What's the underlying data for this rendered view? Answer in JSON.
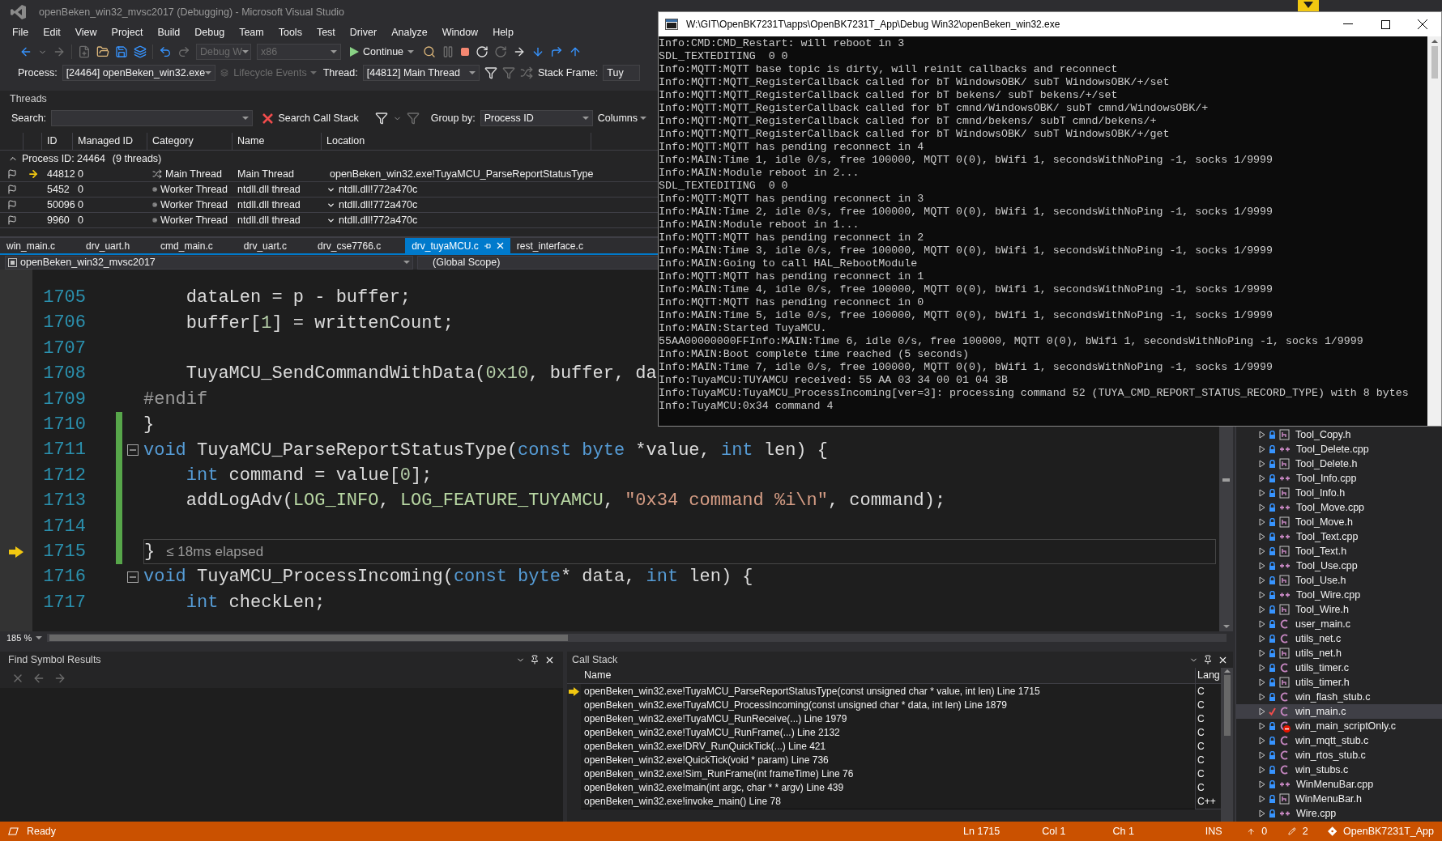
{
  "title": "openBeken_win32_mvsc2017 (Debugging) - Microsoft Visual Studio",
  "menu": [
    "File",
    "Edit",
    "View",
    "Project",
    "Build",
    "Debug",
    "Team",
    "Tools",
    "Test",
    "Driver",
    "Analyze",
    "Window",
    "Help"
  ],
  "toolbar": {
    "configuration": "Debug W",
    "platform": "x86",
    "continue": "Continue"
  },
  "debug_location": {
    "process_label": "Process:",
    "process": "[24464] openBeken_win32.exe",
    "lifecycle": "Lifecycle Events",
    "thread_label": "Thread:",
    "thread": "[44812] Main Thread",
    "stack_frame_label": "Stack Frame:",
    "stack_frame": "Tuy"
  },
  "threads": {
    "title": "Threads",
    "search_label": "Search:",
    "search_call_stack": "Search Call Stack",
    "group_by_label": "Group by:",
    "group_by": "Process ID",
    "columns_button": "Columns",
    "columns": [
      "ID",
      "Managed ID",
      "Category",
      "Name",
      "Location"
    ],
    "group": {
      "label": "Process ID: 24464",
      "count": "(9 threads)",
      "expanded": true
    },
    "rows": [
      {
        "id": "44812",
        "managed_id": "0",
        "kind": "main",
        "category": "Main Thread",
        "name": "Main Thread",
        "location": "openBeken_win32.exe!TuyaMCU_ParseReportStatusType",
        "current": true
      },
      {
        "id": "5452",
        "managed_id": "0",
        "kind": "worker",
        "category": "Worker Thread",
        "name": "ntdll.dll thread",
        "location": "ntdll.dll!772a470c",
        "current": false
      },
      {
        "id": "50096",
        "managed_id": "0",
        "kind": "worker",
        "category": "Worker Thread",
        "name": "ntdll.dll thread",
        "location": "ntdll.dll!772a470c",
        "current": false
      },
      {
        "id": "9960",
        "managed_id": "0",
        "kind": "worker",
        "category": "Worker Thread",
        "name": "ntdll.dll thread",
        "location": "ntdll.dll!772a470c",
        "current": false
      }
    ]
  },
  "editor_tabs": [
    {
      "label": "win_main.c",
      "selected": false
    },
    {
      "label": "drv_uart.h",
      "selected": false
    },
    {
      "label": "cmd_main.c",
      "selected": false
    },
    {
      "label": "drv_uart.c",
      "selected": false
    },
    {
      "label": "drv_cse7766.c",
      "selected": false
    },
    {
      "label": "drv_tuyaMCU.c",
      "selected": true
    },
    {
      "label": "rest_interface.c",
      "selected": false
    }
  ],
  "nav": {
    "project": "openBeken_win32_mvsc2017",
    "scope": "(Global Scope)"
  },
  "code": {
    "elapsed_hint": "≤ 18ms elapsed",
    "lines": [
      {
        "number": "1705",
        "changed": false,
        "fold": false,
        "current": false,
        "tokens": [
          {
            "kind": "plain",
            "text": "    dataLen = p - buffer;"
          }
        ]
      },
      {
        "number": "1706",
        "changed": false,
        "fold": false,
        "current": false,
        "tokens": [
          {
            "kind": "plain",
            "text": "    buffer["
          },
          {
            "kind": "num",
            "text": "1"
          },
          {
            "kind": "plain",
            "text": "] = writtenCount;"
          }
        ]
      },
      {
        "number": "1707",
        "changed": false,
        "fold": false,
        "current": false
      },
      {
        "number": "1708",
        "changed": false,
        "fold": false,
        "current": false,
        "tokens": [
          {
            "kind": "plain",
            "text": "    TuyaMCU_SendCommandWithData("
          },
          {
            "kind": "num",
            "text": "0x10"
          },
          {
            "kind": "plain",
            "text": ", buffer, da"
          }
        ]
      },
      {
        "number": "1709",
        "changed": false,
        "fold": false,
        "current": false,
        "tokens": [
          {
            "kind": "pre",
            "text": "#endif"
          }
        ]
      },
      {
        "number": "1710",
        "changed": true,
        "fold": false,
        "current": false,
        "tokens": [
          {
            "kind": "plain",
            "text": "}"
          }
        ]
      },
      {
        "number": "1711",
        "changed": true,
        "fold": true,
        "current": false,
        "tokens": [
          {
            "kind": "kw",
            "text": "void"
          },
          {
            "kind": "plain",
            "text": " TuyaMCU_ParseReportStatusType("
          },
          {
            "kind": "kw",
            "text": "const byte"
          },
          {
            "kind": "plain",
            "text": " *value, "
          },
          {
            "kind": "kw",
            "text": "int"
          },
          {
            "kind": "plain",
            "text": " len) {"
          }
        ]
      },
      {
        "number": "1712",
        "changed": true,
        "fold": false,
        "current": false,
        "tokens": [
          {
            "kind": "kw",
            "text": "    int"
          },
          {
            "kind": "plain",
            "text": " command = value["
          },
          {
            "kind": "num",
            "text": "0"
          },
          {
            "kind": "plain",
            "text": "];"
          }
        ]
      },
      {
        "number": "1713",
        "changed": true,
        "fold": false,
        "current": false,
        "tokens": [
          {
            "kind": "plain",
            "text": "    addLogAdv("
          },
          {
            "kind": "enum",
            "text": "LOG_INFO"
          },
          {
            "kind": "plain",
            "text": ", "
          },
          {
            "kind": "enum",
            "text": "LOG_FEATURE_TUYAMCU"
          },
          {
            "kind": "plain",
            "text": ", "
          },
          {
            "kind": "str",
            "text": "\"0x34 command %i\\n\""
          },
          {
            "kind": "plain",
            "text": ", command);"
          }
        ]
      },
      {
        "number": "1714",
        "changed": true,
        "fold": false,
        "current": false
      },
      {
        "number": "1715",
        "changed": true,
        "fold": false,
        "current": true,
        "tokens": [
          {
            "kind": "plain",
            "text": "}"
          }
        ]
      },
      {
        "number": "1716",
        "changed": false,
        "fold": true,
        "current": false,
        "tokens": [
          {
            "kind": "kw",
            "text": "void"
          },
          {
            "kind": "plain",
            "text": " TuyaMCU_ProcessIncoming("
          },
          {
            "kind": "kw",
            "text": "const byte"
          },
          {
            "kind": "plain",
            "text": "* data, "
          },
          {
            "kind": "kw",
            "text": "int"
          },
          {
            "kind": "plain",
            "text": " len) {"
          }
        ]
      },
      {
        "number": "1717",
        "changed": false,
        "fold": false,
        "current": false,
        "tokens": [
          {
            "kind": "kw",
            "text": "    int"
          },
          {
            "kind": "plain",
            "text": " checkLen;"
          }
        ]
      }
    ]
  },
  "zoom": "185 %",
  "find_symbol": {
    "title": "Find Symbol Results"
  },
  "call_stack": {
    "title": "Call Stack",
    "columns": [
      "Name",
      "Lang"
    ],
    "rows": [
      {
        "name": "openBeken_win32.exe!TuyaMCU_ParseReportStatusType(const unsigned char * value, int len) Line 1715",
        "lang": "C",
        "current": true
      },
      {
        "name": "openBeken_win32.exe!TuyaMCU_ProcessIncoming(const unsigned char * data, int len) Line 1879",
        "lang": "C",
        "current": false
      },
      {
        "name": "openBeken_win32.exe!TuyaMCU_RunReceive(...) Line 1979",
        "lang": "C",
        "current": false
      },
      {
        "name": "openBeken_win32.exe!TuyaMCU_RunFrame(...) Line 2132",
        "lang": "C",
        "current": false
      },
      {
        "name": "openBeken_win32.exe!DRV_RunQuickTick(...) Line 421",
        "lang": "C",
        "current": false
      },
      {
        "name": "openBeken_win32.exe!QuickTick(void * param) Line 736",
        "lang": "C",
        "current": false
      },
      {
        "name": "openBeken_win32.exe!Sim_RunFrame(int frameTime) Line 76",
        "lang": "C",
        "current": false
      },
      {
        "name": "openBeken_win32.exe!main(int argc, char * * argv) Line 439",
        "lang": "C",
        "current": false
      },
      {
        "name": "openBeken_win32.exe!invoke_main() Line 78",
        "lang": "C++",
        "current": false
      }
    ]
  },
  "console": {
    "title": "W:\\GIT\\OpenBK7231T\\apps\\OpenBK7231T_App\\Debug Win32\\openBeken_win32.exe",
    "lines": [
      "Info:CMD:CMD_Restart: will reboot in 3",
      "SDL_TEXTEDITING  0 0",
      "Info:MQTT:MQTT base topic is dirty, will reinit callbacks and reconnect",
      "Info:MQTT:MQTT_RegisterCallback called for bT WindowsOBK/ subT WindowsOBK/+/set",
      "Info:MQTT:MQTT_RegisterCallback called for bT bekens/ subT bekens/+/set",
      "Info:MQTT:MQTT_RegisterCallback called for bT cmnd/WindowsOBK/ subT cmnd/WindowsOBK/+",
      "Info:MQTT:MQTT_RegisterCallback called for bT cmnd/bekens/ subT cmnd/bekens/+",
      "Info:MQTT:MQTT_RegisterCallback called for bT WindowsOBK/ subT WindowsOBK/+/get",
      "Info:MQTT:MQTT has pending reconnect in 4",
      "Info:MAIN:Time 1, idle 0/s, free 100000, MQTT 0(0), bWifi 1, secondsWithNoPing -1, socks 1/9999",
      "Info:MAIN:Module reboot in 2...",
      "SDL_TEXTEDITING  0 0",
      "Info:MQTT:MQTT has pending reconnect in 3",
      "Info:MAIN:Time 2, idle 0/s, free 100000, MQTT 0(0), bWifi 1, secondsWithNoPing -1, socks 1/9999",
      "Info:MAIN:Module reboot in 1...",
      "Info:MQTT:MQTT has pending reconnect in 2",
      "Info:MAIN:Time 3, idle 0/s, free 100000, MQTT 0(0), bWifi 1, secondsWithNoPing -1, socks 1/9999",
      "Info:MAIN:Going to call HAL_RebootModule",
      "Info:MQTT:MQTT has pending reconnect in 1",
      "Info:MAIN:Time 4, idle 0/s, free 100000, MQTT 0(0), bWifi 1, secondsWithNoPing -1, socks 1/9999",
      "Info:MQTT:MQTT has pending reconnect in 0",
      "Info:MAIN:Time 5, idle 0/s, free 100000, MQTT 0(0), bWifi 1, secondsWithNoPing -1, socks 1/9999",
      "Info:MAIN:Started TuyaMCU.",
      "55AA00000000FFInfo:MAIN:Time 6, idle 0/s, free 100000, MQTT 0(0), bWifi 1, secondsWithNoPing -1, socks 1/9999",
      "Info:MAIN:Boot complete time reached (5 seconds)",
      "Info:MAIN:Time 7, idle 0/s, free 100000, MQTT 0(0), bWifi 1, secondsWithNoPing -1, socks 1/9999",
      "Info:TuyaMCU:TUYAMCU received: 55 AA 03 34 00 01 04 3B",
      "Info:TuyaMCU:TuyaMCU_ProcessIncoming[ver=3]: processing command 52 (TUYA_CMD_REPORT_STATUS_RECORD_TYPE) with 8 bytes",
      "Info:TuyaMCU:0x34 command 4"
    ]
  },
  "solution_explorer": {
    "items": [
      {
        "name": "Tool_Copy.h",
        "kind": "h",
        "locked": true,
        "checked_out": false,
        "excluded": false,
        "selected": false
      },
      {
        "name": "Tool_Delete.cpp",
        "kind": "cpp",
        "locked": true,
        "checked_out": false,
        "excluded": false,
        "selected": false
      },
      {
        "name": "Tool_Delete.h",
        "kind": "h",
        "locked": true,
        "checked_out": false,
        "excluded": false,
        "selected": false
      },
      {
        "name": "Tool_Info.cpp",
        "kind": "cpp",
        "locked": true,
        "checked_out": false,
        "excluded": false,
        "selected": false
      },
      {
        "name": "Tool_Info.h",
        "kind": "h",
        "locked": true,
        "checked_out": false,
        "excluded": false,
        "selected": false
      },
      {
        "name": "Tool_Move.cpp",
        "kind": "cpp",
        "locked": true,
        "checked_out": false,
        "excluded": false,
        "selected": false
      },
      {
        "name": "Tool_Move.h",
        "kind": "h",
        "locked": true,
        "checked_out": false,
        "excluded": false,
        "selected": false
      },
      {
        "name": "Tool_Text.cpp",
        "kind": "cpp",
        "locked": true,
        "checked_out": false,
        "excluded": false,
        "selected": false
      },
      {
        "name": "Tool_Text.h",
        "kind": "h",
        "locked": true,
        "checked_out": false,
        "excluded": false,
        "selected": false
      },
      {
        "name": "Tool_Use.cpp",
        "kind": "cpp",
        "locked": true,
        "checked_out": false,
        "excluded": false,
        "selected": false
      },
      {
        "name": "Tool_Use.h",
        "kind": "h",
        "locked": true,
        "checked_out": false,
        "excluded": false,
        "selected": false
      },
      {
        "name": "Tool_Wire.cpp",
        "kind": "cpp",
        "locked": true,
        "checked_out": false,
        "excluded": false,
        "selected": false
      },
      {
        "name": "Tool_Wire.h",
        "kind": "h",
        "locked": true,
        "checked_out": false,
        "excluded": false,
        "selected": false
      },
      {
        "name": "user_main.c",
        "kind": "c",
        "locked": true,
        "checked_out": false,
        "excluded": false,
        "selected": false
      },
      {
        "name": "utils_net.c",
        "kind": "c",
        "locked": true,
        "checked_out": false,
        "excluded": false,
        "selected": false
      },
      {
        "name": "utils_net.h",
        "kind": "h",
        "locked": true,
        "checked_out": false,
        "excluded": false,
        "selected": false
      },
      {
        "name": "utils_timer.c",
        "kind": "c",
        "locked": true,
        "checked_out": false,
        "excluded": false,
        "selected": false
      },
      {
        "name": "utils_timer.h",
        "kind": "h",
        "locked": true,
        "checked_out": false,
        "excluded": false,
        "selected": false
      },
      {
        "name": "win_flash_stub.c",
        "kind": "c",
        "locked": true,
        "checked_out": false,
        "excluded": false,
        "selected": false
      },
      {
        "name": "win_main.c",
        "kind": "c",
        "locked": false,
        "checked_out": true,
        "excluded": false,
        "selected": true
      },
      {
        "name": "win_main_scriptOnly.c",
        "kind": "c",
        "locked": true,
        "checked_out": false,
        "excluded": true,
        "selected": false
      },
      {
        "name": "win_mqtt_stub.c",
        "kind": "c",
        "locked": true,
        "checked_out": false,
        "excluded": false,
        "selected": false
      },
      {
        "name": "win_rtos_stub.c",
        "kind": "c",
        "locked": true,
        "checked_out": false,
        "excluded": false,
        "selected": false
      },
      {
        "name": "win_stubs.c",
        "kind": "c",
        "locked": true,
        "checked_out": false,
        "excluded": false,
        "selected": false
      },
      {
        "name": "WinMenuBar.cpp",
        "kind": "cpp",
        "locked": true,
        "checked_out": false,
        "excluded": false,
        "selected": false
      },
      {
        "name": "WinMenuBar.h",
        "kind": "h",
        "locked": true,
        "checked_out": false,
        "excluded": false,
        "selected": false
      },
      {
        "name": "Wire.cpp",
        "kind": "cpp",
        "locked": true,
        "checked_out": false,
        "excluded": false,
        "selected": false
      }
    ]
  },
  "status_bar": {
    "message": "Ready",
    "line": "Ln 1715",
    "column": "Col 1",
    "char": "Ch 1",
    "mode": "INS",
    "unpushed": "0",
    "changes": "2",
    "repository": "OpenBK7231T_App"
  }
}
